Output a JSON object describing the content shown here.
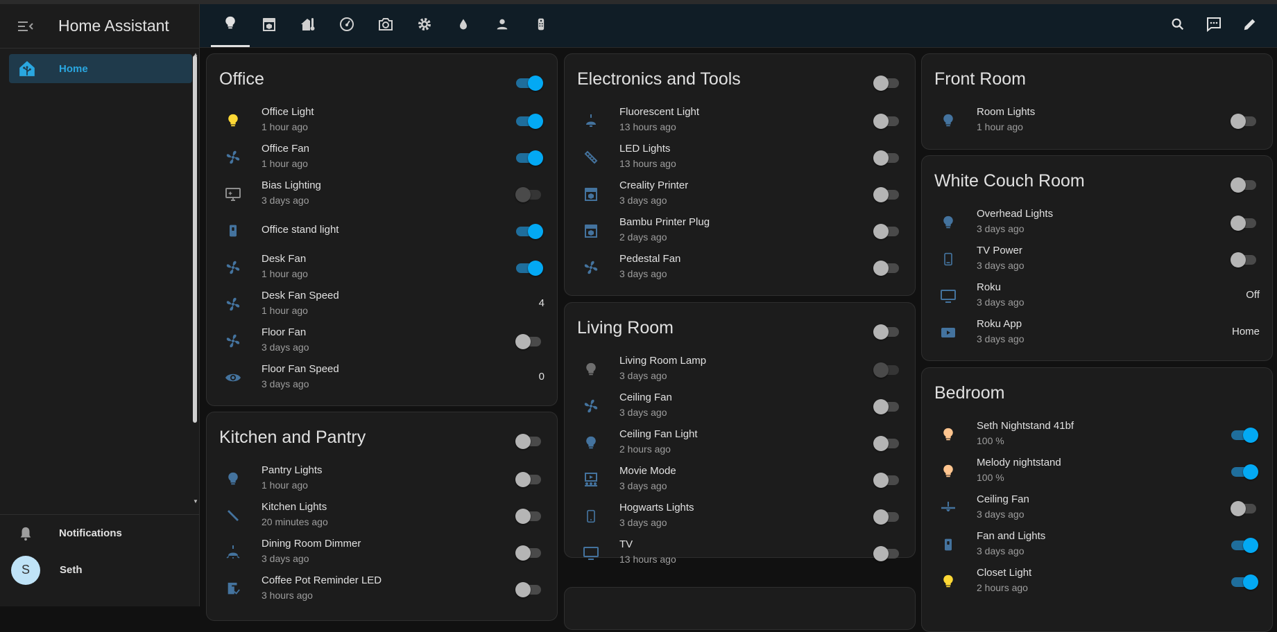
{
  "app": {
    "title": "Home Assistant"
  },
  "sidebar": {
    "items": [
      {
        "label": "Home",
        "icon": "home-assistant-icon"
      }
    ],
    "notifications_label": "Notifications",
    "user": {
      "name": "Seth",
      "initial": "S"
    }
  },
  "tabs": [
    {
      "name": "lights",
      "icon": "lightbulb-icon",
      "active": true
    },
    {
      "name": "printer3d",
      "icon": "printer-3d-icon"
    },
    {
      "name": "climate",
      "icon": "home-thermometer-icon"
    },
    {
      "name": "gauge",
      "icon": "gauge-icon"
    },
    {
      "name": "camera",
      "icon": "camera-icon"
    },
    {
      "name": "settings",
      "icon": "gear-icon"
    },
    {
      "name": "water",
      "icon": "water-icon"
    },
    {
      "name": "person",
      "icon": "person-icon"
    },
    {
      "name": "remote",
      "icon": "remote-icon"
    }
  ],
  "toolbar": [
    "search-icon",
    "assist-icon",
    "edit-icon"
  ],
  "colors": {
    "accent": "#03a9f4",
    "icon_blue": "#44739e",
    "yellow": "#fdd835",
    "warm": "#ffc58f"
  },
  "cards": {
    "office": {
      "title": "Office",
      "toggle": "on",
      "rows": [
        {
          "name": "Office Light",
          "status": "1 hour ago",
          "icon": "lightbulb-icon",
          "color": "yellow",
          "control": "on"
        },
        {
          "name": "Office Fan",
          "status": "1 hour ago",
          "icon": "fan-icon",
          "control": "on"
        },
        {
          "name": "Bias Lighting",
          "status": "3 days ago",
          "icon": "monitor-icon",
          "color": "gray",
          "control": "off-dim"
        },
        {
          "name": "Office stand light",
          "status": "",
          "icon": "light-switch-icon",
          "control": "on"
        },
        {
          "name": "Desk Fan",
          "status": "1 hour ago",
          "icon": "fan-icon",
          "control": "on"
        },
        {
          "name": "Desk Fan Speed",
          "status": "1 hour ago",
          "icon": "fan-icon",
          "value": "4"
        },
        {
          "name": "Floor Fan",
          "status": "3 days ago",
          "icon": "fan-icon",
          "control": "off"
        },
        {
          "name": "Floor Fan Speed",
          "status": "3 days ago",
          "icon": "eye-icon",
          "value": "0"
        }
      ]
    },
    "kitchen": {
      "title": "Kitchen and Pantry",
      "toggle": "off",
      "rows": [
        {
          "name": "Pantry Lights",
          "status": "1 hour ago",
          "icon": "lightbulb-icon",
          "control": "off"
        },
        {
          "name": "Kitchen Lights",
          "status": "20 minutes ago",
          "icon": "led-strip-icon",
          "control": "off"
        },
        {
          "name": "Dining Room Dimmer",
          "status": "3 days ago",
          "icon": "ceiling-light-icon",
          "control": "off"
        },
        {
          "name": "Coffee Pot Reminder LED",
          "status": "3 hours ago",
          "icon": "coffee-maker-icon",
          "control": "off"
        }
      ]
    },
    "electronics": {
      "title": "Electronics and Tools",
      "toggle": "off",
      "rows": [
        {
          "name": "Fluorescent Light",
          "status": "13 hours ago",
          "icon": "ceiling-light-icon",
          "control": "off"
        },
        {
          "name": "LED Lights",
          "status": "13 hours ago",
          "icon": "led-strip-icon",
          "control": "off"
        },
        {
          "name": "Creality Printer",
          "status": "3 days ago",
          "icon": "printer-3d-icon",
          "control": "off"
        },
        {
          "name": "Bambu Printer Plug",
          "status": "2 days ago",
          "icon": "printer-3d-icon",
          "control": "off"
        },
        {
          "name": "Pedestal Fan",
          "status": "3 days ago",
          "icon": "fan-icon",
          "control": "off"
        }
      ]
    },
    "living": {
      "title": "Living Room",
      "toggle": "off",
      "rows": [
        {
          "name": "Living Room Lamp",
          "status": "3 days ago",
          "icon": "lightbulb-icon",
          "color": "gray",
          "control": "off-dim"
        },
        {
          "name": "Ceiling Fan",
          "status": "3 days ago",
          "icon": "fan-icon",
          "control": "off"
        },
        {
          "name": "Ceiling Fan Light",
          "status": "2 hours ago",
          "icon": "lightbulb-icon",
          "control": "off"
        },
        {
          "name": "Movie Mode",
          "status": "3 days ago",
          "icon": "theater-icon",
          "control": "off"
        },
        {
          "name": "Hogwarts Lights",
          "status": "3 days ago",
          "icon": "tablet-icon",
          "control": "off"
        },
        {
          "name": "TV",
          "status": "13 hours ago",
          "icon": "television-icon",
          "control": "off"
        }
      ]
    },
    "front": {
      "title": "Front Room",
      "rows": [
        {
          "name": "Room Lights",
          "status": "1 hour ago",
          "icon": "lightbulb-icon",
          "control": "off"
        }
      ]
    },
    "couch": {
      "title": "White Couch Room",
      "toggle": "off",
      "rows": [
        {
          "name": "Overhead Lights",
          "status": "3 days ago",
          "icon": "lightbulb-icon",
          "control": "off"
        },
        {
          "name": "TV Power",
          "status": "3 days ago",
          "icon": "cellphone-icon",
          "control": "off"
        },
        {
          "name": "Roku",
          "status": "3 days ago",
          "icon": "television-icon",
          "value": "Off"
        },
        {
          "name": "Roku App",
          "status": "3 days ago",
          "icon": "play-box-icon",
          "value": "Home"
        }
      ]
    },
    "bedroom": {
      "title": "Bedroom",
      "rows": [
        {
          "name": "Seth Nightstand 41bf",
          "status": "100 %",
          "icon": "lightbulb-icon",
          "color": "warm",
          "control": "on"
        },
        {
          "name": "Melody nightstand",
          "status": "100 %",
          "icon": "lightbulb-icon",
          "color": "warm",
          "control": "on"
        },
        {
          "name": "Ceiling Fan",
          "status": "3 days ago",
          "icon": "ceiling-fan-icon",
          "control": "off"
        },
        {
          "name": "Fan and Lights",
          "status": "3 days ago",
          "icon": "light-switch-icon",
          "control": "on"
        },
        {
          "name": "Closet Light",
          "status": "2 hours ago",
          "icon": "lightbulb-icon",
          "color": "yellow",
          "control": "on"
        }
      ]
    }
  }
}
